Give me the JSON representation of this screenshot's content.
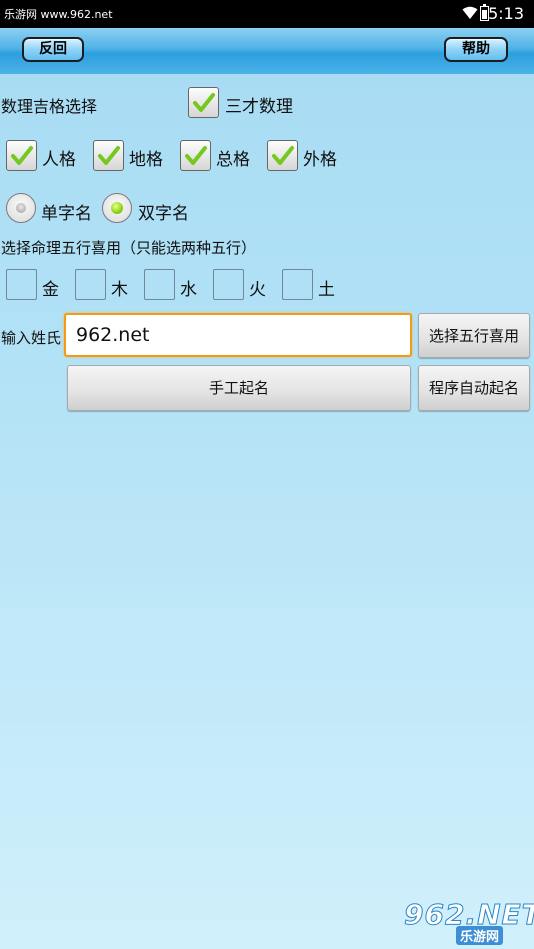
{
  "status_bar": {
    "site_text": "乐游网 www.962.net",
    "time": "5:13"
  },
  "title_bar": {
    "back_label": "反回",
    "help_label": "帮助"
  },
  "grid_section": {
    "label": "数理吉格选择",
    "sancai": {
      "label": "三才数理",
      "checked": true
    },
    "options": [
      {
        "label": "人格",
        "checked": true
      },
      {
        "label": "地格",
        "checked": true
      },
      {
        "label": "总格",
        "checked": true
      },
      {
        "label": "外格",
        "checked": true
      }
    ]
  },
  "name_length": {
    "single_label": "单字名",
    "double_label": "双字名",
    "selected": "双字名"
  },
  "wuxing_section": {
    "label": "选择命理五行喜用（只能选两种五行）",
    "elements": [
      {
        "label": "金",
        "checked": false
      },
      {
        "label": "木",
        "checked": false
      },
      {
        "label": "水",
        "checked": false
      },
      {
        "label": "火",
        "checked": false
      },
      {
        "label": "土",
        "checked": false
      }
    ]
  },
  "surname": {
    "label": "输入姓氏",
    "value": "962.net"
  },
  "buttons": {
    "choose_wuxing": "选择五行喜用",
    "manual_naming": "手工起名",
    "auto_naming": "程序自动起名"
  },
  "watermark": {
    "big_text": "962.NET",
    "small_text": "乐游网"
  },
  "colors": {
    "accent_input_border": "#f59a16",
    "check_green": "#74c81e",
    "title_bar_blue": "#2d9edf"
  }
}
